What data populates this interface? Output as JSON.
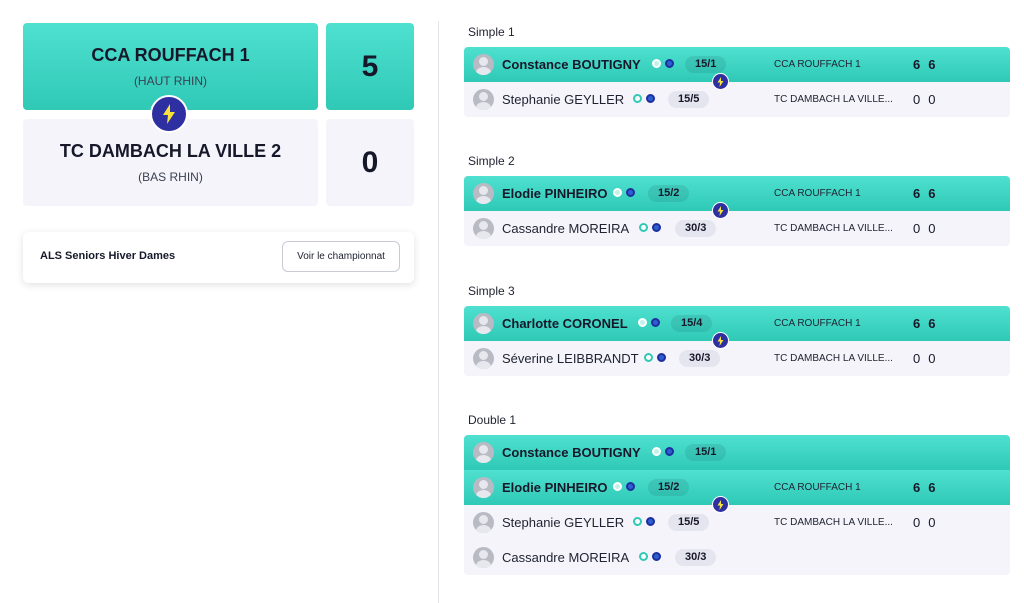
{
  "match": {
    "home": {
      "name": "CCA ROUFFACH 1",
      "region": "(HAUT RHIN)",
      "score": "5"
    },
    "away": {
      "name": "TC DAMBACH LA VILLE 2",
      "region": "(BAS RHIN)",
      "score": "0"
    }
  },
  "championship": {
    "name": "ALS Seniors Hiver Dames",
    "button_label": "Voir le championnat"
  },
  "games": [
    {
      "title": "Simple 1",
      "rows": [
        {
          "player": "Constance BOUTIGNY",
          "rank": "15/1",
          "club": "CCA ROUFFACH 1",
          "set1": "6",
          "set2": "6"
        },
        {
          "player": "Stephanie GEYLLER",
          "rank": "15/5",
          "club": "TC DAMBACH LA VILLE...",
          "set1": "0",
          "set2": "0"
        }
      ]
    },
    {
      "title": "Simple 2",
      "rows": [
        {
          "player": "Elodie PINHEIRO",
          "rank": "15/2",
          "club": "CCA ROUFFACH 1",
          "set1": "6",
          "set2": "6"
        },
        {
          "player": "Cassandre MOREIRA",
          "rank": "30/3",
          "club": "TC DAMBACH LA VILLE...",
          "set1": "0",
          "set2": "0"
        }
      ]
    },
    {
      "title": "Simple 3",
      "rows": [
        {
          "player": "Charlotte CORONEL",
          "rank": "15/4",
          "club": "CCA ROUFFACH 1",
          "set1": "6",
          "set2": "6"
        },
        {
          "player": "Séverine LEIBBRANDT",
          "rank": "30/3",
          "club": "TC DAMBACH LA VILLE...",
          "set1": "0",
          "set2": "0"
        }
      ]
    },
    {
      "title": "Double 1",
      "rows": [
        {
          "player": "Constance BOUTIGNY",
          "rank": "15/1"
        },
        {
          "player": "Elodie PINHEIRO",
          "rank": "15/2",
          "club": "CCA ROUFFACH 1",
          "set1": "6",
          "set2": "6"
        },
        {
          "player": "Stephanie GEYLLER",
          "rank": "15/5",
          "club": "TC DAMBACH LA VILLE...",
          "set1": "0",
          "set2": "0"
        },
        {
          "player": "Cassandre MOREIRA",
          "rank": "30/3"
        }
      ]
    }
  ],
  "icons": {
    "winner_badge": "lightning-bolt-icon",
    "avatar": "user-avatar-icon",
    "status_ring": "ring-dot-icon",
    "status_fill": "filled-dot-icon"
  },
  "colors": {
    "accent": "#3fd6c3",
    "badge": "#2e2fa0",
    "panel": "#f4f4fa"
  }
}
